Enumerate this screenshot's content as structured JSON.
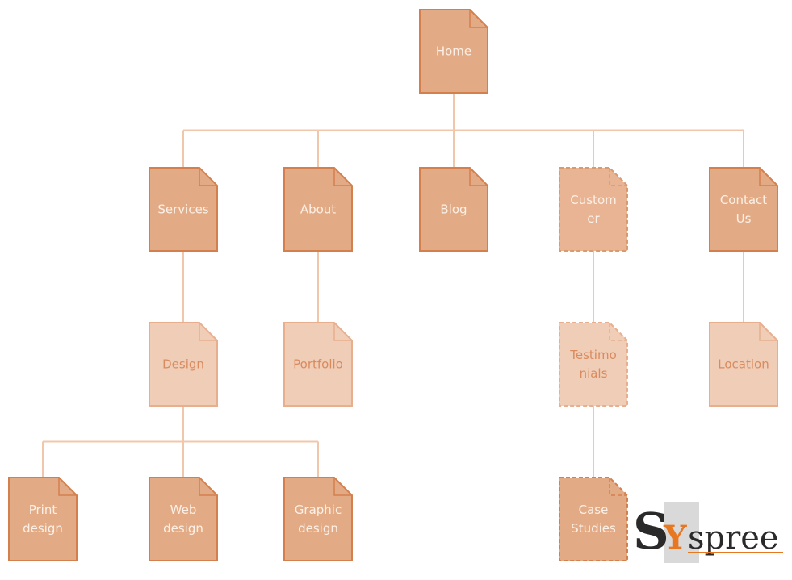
{
  "colors": {
    "connector": "#f0c7ab",
    "dark_fill": "#e2ab86",
    "dark_stroke": "#d4804e",
    "dark_text": "#fcf0e6",
    "light_fill": "#f0cdb7",
    "light_stroke": "#e8af8e",
    "light_text": "#d98b5e",
    "logo_orange": "#e87722",
    "logo_dark": "#2a2a2a"
  },
  "nodes": [
    {
      "id": "home",
      "lines": [
        "Home"
      ],
      "style": "dark",
      "dashed": false,
      "parent": null
    },
    {
      "id": "services",
      "lines": [
        "Services"
      ],
      "style": "dark",
      "dashed": false,
      "parent": "home"
    },
    {
      "id": "about",
      "lines": [
        "About"
      ],
      "style": "dark",
      "dashed": false,
      "parent": "home"
    },
    {
      "id": "blog",
      "lines": [
        "Blog"
      ],
      "style": "dark",
      "dashed": false,
      "parent": "home"
    },
    {
      "id": "customer",
      "lines": [
        "Custom",
        "er"
      ],
      "style": "medium",
      "dashed": true,
      "parent": "home"
    },
    {
      "id": "contact-us",
      "lines": [
        "Contact",
        "Us"
      ],
      "style": "dark",
      "dashed": false,
      "parent": "home"
    },
    {
      "id": "design",
      "lines": [
        "Design"
      ],
      "style": "light",
      "dashed": false,
      "parent": "services"
    },
    {
      "id": "portfolio",
      "lines": [
        "Portfolio"
      ],
      "style": "light",
      "dashed": false,
      "parent": "about"
    },
    {
      "id": "testimonials",
      "lines": [
        "Testimo",
        "nials"
      ],
      "style": "light",
      "dashed": true,
      "parent": "customer"
    },
    {
      "id": "location",
      "lines": [
        "Location"
      ],
      "style": "light",
      "dashed": false,
      "parent": "contact-us"
    },
    {
      "id": "print-design",
      "lines": [
        "Print",
        "design"
      ],
      "style": "dark",
      "dashed": false,
      "parent": "design"
    },
    {
      "id": "web-design",
      "lines": [
        "Web",
        "design"
      ],
      "style": "dark",
      "dashed": false,
      "parent": "design"
    },
    {
      "id": "graphic-design",
      "lines": [
        "Graphic",
        "design"
      ],
      "style": "dark",
      "dashed": false,
      "parent": "design"
    },
    {
      "id": "case-studies",
      "lines": [
        "Case",
        "Studies"
      ],
      "style": "dark",
      "dashed": true,
      "parent": "testimonials"
    }
  ],
  "logo": {
    "text": "Syspree",
    "first": "S",
    "accent": "Y",
    "rest": "spree"
  }
}
